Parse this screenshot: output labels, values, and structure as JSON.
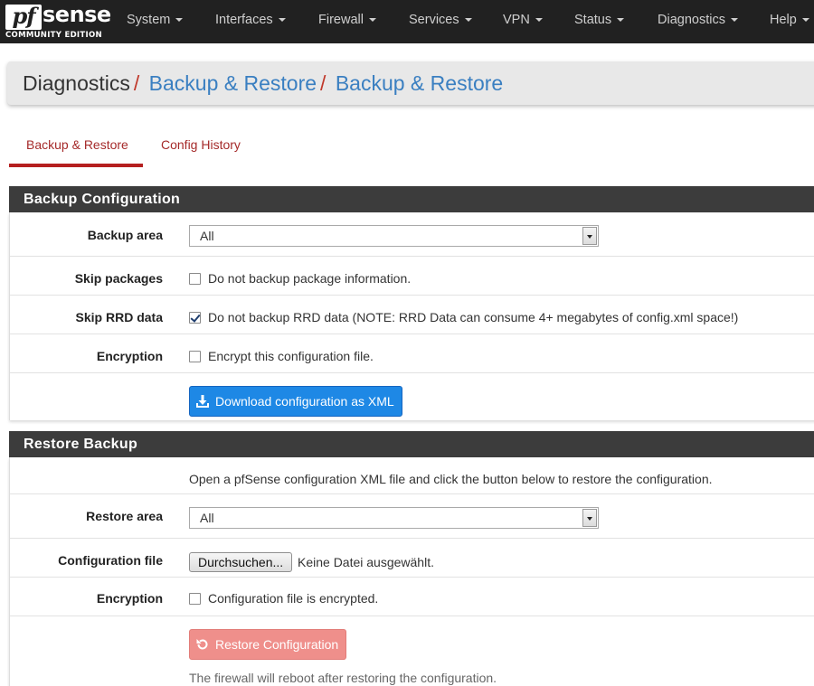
{
  "brand": {
    "logo_pf": "pf",
    "logo_sense": "sense",
    "edition": "COMMUNITY EDITION"
  },
  "nav": {
    "items": [
      "System",
      "Interfaces",
      "Firewall",
      "Services",
      "VPN",
      "Status",
      "Diagnostics",
      "Help"
    ]
  },
  "breadcrumb": {
    "root": "Diagnostics",
    "separator": "/",
    "level1": "Backup & Restore",
    "level2": "Backup & Restore"
  },
  "tabs": {
    "active": "Backup & Restore",
    "other": "Config History"
  },
  "backup": {
    "heading": "Backup Configuration",
    "area_label": "Backup area",
    "area_value": "All",
    "skip_packages_label": "Skip packages",
    "skip_packages_text": "Do not backup package information.",
    "skip_packages_checked": false,
    "skip_rrd_label": "Skip RRD data",
    "skip_rrd_text": "Do not backup RRD data (NOTE: RRD Data can consume 4+ megabytes of config.xml space!)",
    "skip_rrd_checked": true,
    "encryption_label": "Encryption",
    "encryption_text": "Encrypt this configuration file.",
    "encryption_checked": false,
    "download_button": "Download configuration as XML"
  },
  "restore": {
    "heading": "Restore Backup",
    "intro": "Open a pfSense configuration XML file and click the button below to restore the configuration.",
    "area_label": "Restore area",
    "area_value": "All",
    "file_label": "Configuration file",
    "browse_button": "Durchsuchen...",
    "file_status": "Keine Datei ausgewählt.",
    "encryption_label": "Encryption",
    "encryption_text": "Configuration file is encrypted.",
    "encryption_checked": false,
    "restore_button": "Restore Configuration",
    "help": "The firewall will reboot after restoring the configuration."
  },
  "colors": {
    "navbar": "#212121",
    "panel_heading": "#3c3c3c",
    "accent_red": "#b51f1f",
    "link_blue": "#3a7fc1",
    "primary_button": "#1e88e5",
    "danger_disabled": "#ef8f8b"
  },
  "icons": {
    "download": "download-icon",
    "restore": "undo-icon",
    "caret": "chevron-down-icon"
  }
}
